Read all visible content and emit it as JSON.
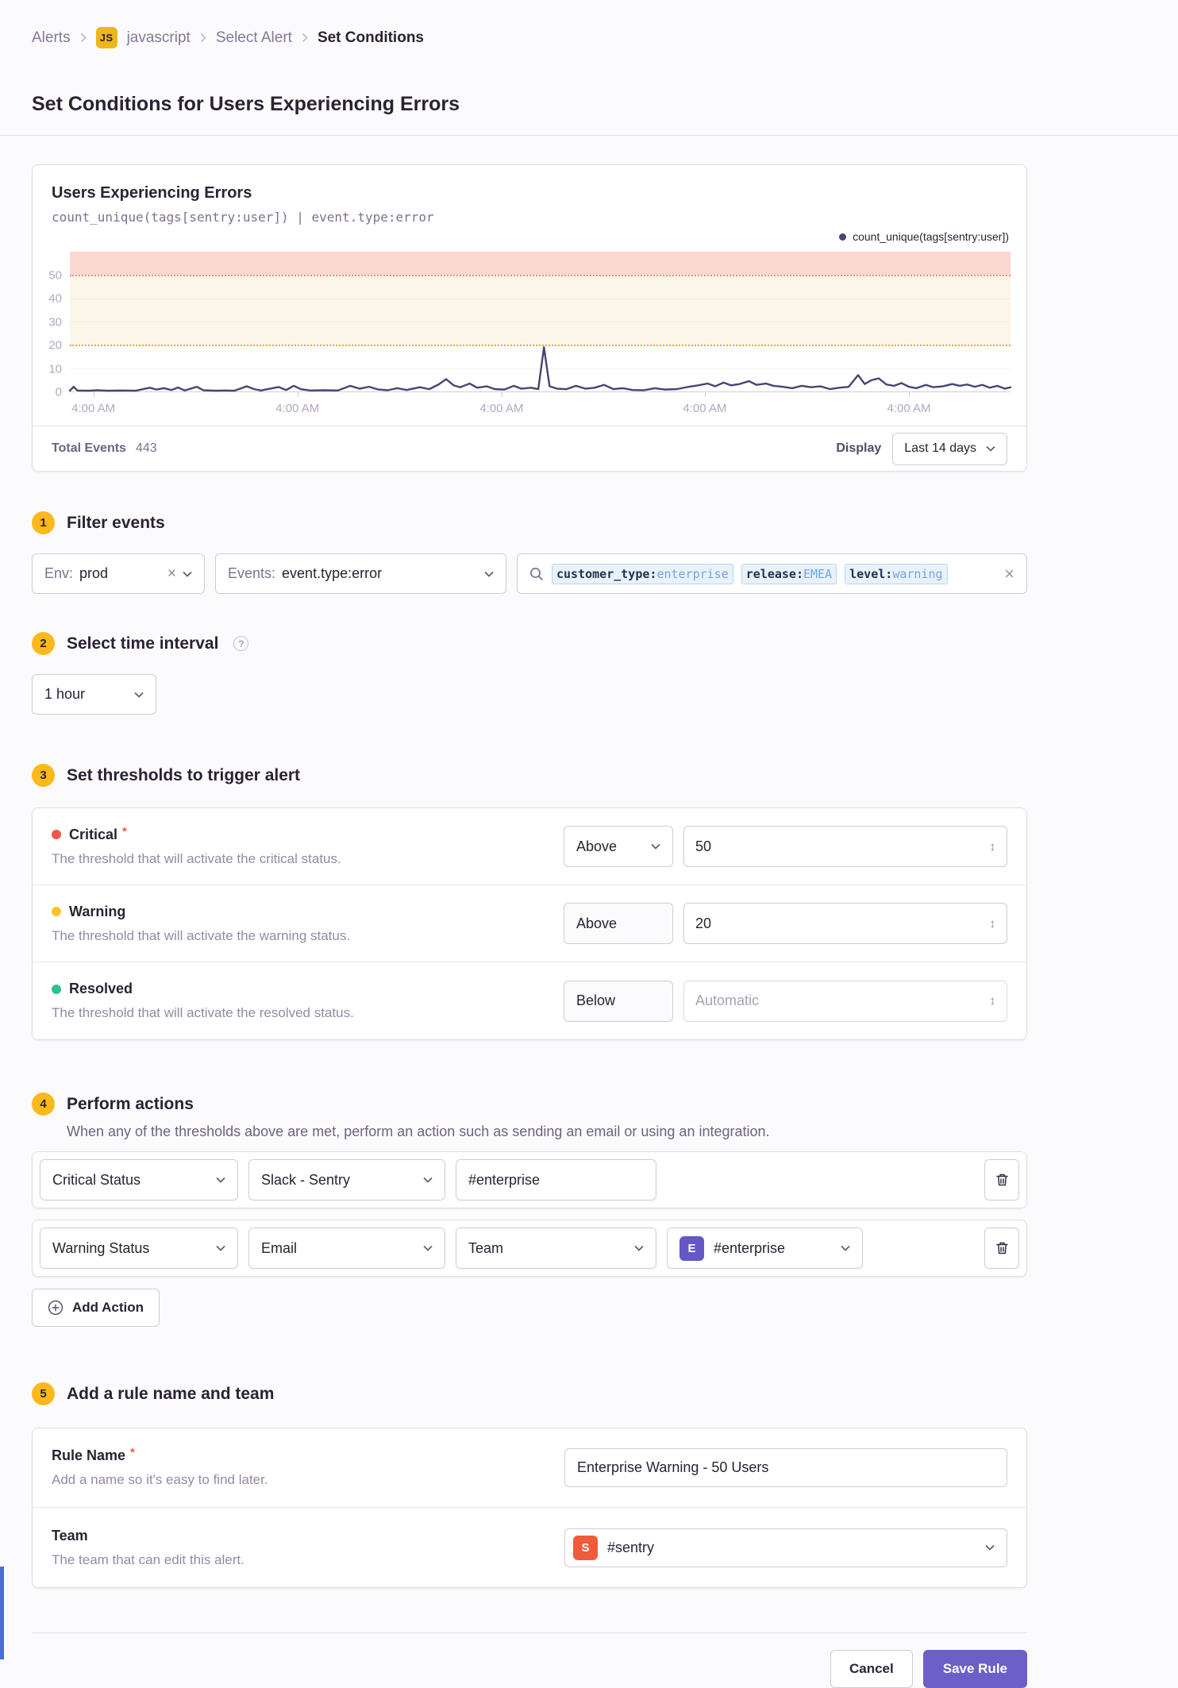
{
  "breadcrumb": {
    "items": [
      "Alerts",
      "javascript",
      "Select Alert",
      "Set Conditions"
    ],
    "project_badge": "JS"
  },
  "page_title": "Set Conditions for Users Experiencing Errors",
  "chart": {
    "title": "Users Experiencing Errors",
    "query": "count_unique(tags[sentry:user]) | event.type:error",
    "legend_label": "count_unique(tags[sentry:user])",
    "footer": {
      "total_events_label": "Total Events",
      "total_events_value": "443",
      "display_label": "Display",
      "display_value": "Last 14 days"
    }
  },
  "chart_data": {
    "type": "line",
    "series_name": "count_unique(tags[sentry:user])",
    "title": "Users Experiencing Errors",
    "ylim": [
      0,
      60
    ],
    "y_ticks": [
      0,
      10,
      20,
      30,
      40,
      50
    ],
    "gridline_values": [
      10,
      30,
      40
    ],
    "critical_threshold": 50,
    "warning_threshold": 20,
    "x_tick_labels": [
      "4:00 AM",
      "4:00 AM",
      "4:00 AM",
      "4:00 AM",
      "4:00 AM"
    ],
    "x_tick_fractions": [
      0.025,
      0.242,
      0.459,
      0.675,
      0.892
    ],
    "total_events": 443,
    "points": [
      [
        0.0,
        0.3
      ],
      [
        0.004,
        2.0
      ],
      [
        0.008,
        0.4
      ],
      [
        0.02,
        0.3
      ],
      [
        0.03,
        0.5
      ],
      [
        0.04,
        0.3
      ],
      [
        0.055,
        0.4
      ],
      [
        0.07,
        0.3
      ],
      [
        0.085,
        1.6
      ],
      [
        0.092,
        0.8
      ],
      [
        0.1,
        1.4
      ],
      [
        0.108,
        0.6
      ],
      [
        0.115,
        1.7
      ],
      [
        0.122,
        0.4
      ],
      [
        0.135,
        2.0
      ],
      [
        0.142,
        0.5
      ],
      [
        0.155,
        0.3
      ],
      [
        0.165,
        0.4
      ],
      [
        0.175,
        0.3
      ],
      [
        0.188,
        2.2
      ],
      [
        0.196,
        1.0
      ],
      [
        0.203,
        0.4
      ],
      [
        0.222,
        1.9
      ],
      [
        0.23,
        0.6
      ],
      [
        0.238,
        2.4
      ],
      [
        0.246,
        0.9
      ],
      [
        0.256,
        0.4
      ],
      [
        0.27,
        0.5
      ],
      [
        0.285,
        0.4
      ],
      [
        0.298,
        2.4
      ],
      [
        0.308,
        1.2
      ],
      [
        0.318,
        2.0
      ],
      [
        0.328,
        0.8
      ],
      [
        0.338,
        0.5
      ],
      [
        0.348,
        1.4
      ],
      [
        0.358,
        0.6
      ],
      [
        0.372,
        1.8
      ],
      [
        0.382,
        1.0
      ],
      [
        0.392,
        3.0
      ],
      [
        0.4,
        5.3
      ],
      [
        0.408,
        2.6
      ],
      [
        0.415,
        1.8
      ],
      [
        0.425,
        3.4
      ],
      [
        0.433,
        1.6
      ],
      [
        0.443,
        2.2
      ],
      [
        0.452,
        1.0
      ],
      [
        0.462,
        0.8
      ],
      [
        0.472,
        2.4
      ],
      [
        0.48,
        1.2
      ],
      [
        0.49,
        1.6
      ],
      [
        0.498,
        1.0
      ],
      [
        0.504,
        19.0
      ],
      [
        0.51,
        2.2
      ],
      [
        0.518,
        1.2
      ],
      [
        0.528,
        1.0
      ],
      [
        0.538,
        2.4
      ],
      [
        0.548,
        1.2
      ],
      [
        0.558,
        1.6
      ],
      [
        0.568,
        2.8
      ],
      [
        0.578,
        1.0
      ],
      [
        0.588,
        1.4
      ],
      [
        0.598,
        0.6
      ],
      [
        0.61,
        0.5
      ],
      [
        0.622,
        1.4
      ],
      [
        0.632,
        0.8
      ],
      [
        0.645,
        1.0
      ],
      [
        0.658,
        2.0
      ],
      [
        0.668,
        2.6
      ],
      [
        0.678,
        3.4
      ],
      [
        0.686,
        2.2
      ],
      [
        0.695,
        3.8
      ],
      [
        0.703,
        2.6
      ],
      [
        0.712,
        3.2
      ],
      [
        0.722,
        4.4
      ],
      [
        0.73,
        2.8
      ],
      [
        0.74,
        3.4
      ],
      [
        0.748,
        2.4
      ],
      [
        0.758,
        2.0
      ],
      [
        0.768,
        1.4
      ],
      [
        0.778,
        2.4
      ],
      [
        0.788,
        1.8
      ],
      [
        0.798,
        2.2
      ],
      [
        0.808,
        1.0
      ],
      [
        0.818,
        1.6
      ],
      [
        0.828,
        2.0
      ],
      [
        0.838,
        7.0
      ],
      [
        0.845,
        3.2
      ],
      [
        0.852,
        4.8
      ],
      [
        0.86,
        5.6
      ],
      [
        0.868,
        3.0
      ],
      [
        0.876,
        2.4
      ],
      [
        0.884,
        3.6
      ],
      [
        0.892,
        2.0
      ],
      [
        0.9,
        1.4
      ],
      [
        0.91,
        2.8
      ],
      [
        0.918,
        1.8
      ],
      [
        0.928,
        2.2
      ],
      [
        0.938,
        3.2
      ],
      [
        0.946,
        2.4
      ],
      [
        0.954,
        3.0
      ],
      [
        0.962,
        2.0
      ],
      [
        0.97,
        2.8
      ],
      [
        0.978,
        1.6
      ],
      [
        0.986,
        2.4
      ],
      [
        0.994,
        1.2
      ],
      [
        1.0,
        1.8
      ]
    ]
  },
  "steps": {
    "filter": {
      "number": "1",
      "title": "Filter events",
      "environment": {
        "label": "Env:",
        "value": "prod"
      },
      "events": {
        "label": "Events:",
        "value": "event.type:error"
      },
      "search_tokens": [
        {
          "key": "customer_type",
          "value": "enterprise"
        },
        {
          "key": "release",
          "value": "EMEA"
        },
        {
          "key": "level",
          "value": "warning"
        }
      ]
    },
    "interval": {
      "number": "2",
      "title": "Select time interval",
      "help": "?",
      "value": "1 hour"
    },
    "thresholds": {
      "number": "3",
      "title": "Set thresholds to trigger alert",
      "rows": [
        {
          "name": "Critical",
          "required": true,
          "description": "The threshold that will activate the critical status.",
          "comparator": "Above",
          "value": "50",
          "placeholder": ""
        },
        {
          "name": "Warning",
          "required": false,
          "description": "The threshold that will activate the warning status.",
          "comparator": "Above",
          "value": "20",
          "placeholder": ""
        },
        {
          "name": "Resolved",
          "required": false,
          "description": "The threshold that will activate the resolved status.",
          "comparator": "Below",
          "value": "",
          "placeholder": "Automatic"
        }
      ]
    },
    "actions": {
      "number": "4",
      "title": "Perform actions",
      "description": "When any of the thresholds above are met, perform an action such as sending an email or using an integration.",
      "row1": {
        "trigger": "Critical Status",
        "integration": "Slack - Sentry",
        "channel": "#enterprise"
      },
      "row2": {
        "trigger": "Warning Status",
        "method": "Email",
        "target": "Team",
        "team_badge": "E",
        "team": "#enterprise"
      },
      "add_label": "Add Action"
    },
    "naming": {
      "number": "5",
      "title": "Add a rule name and team",
      "rule_name": {
        "label": "Rule Name",
        "required": true,
        "description": "Add a name so it's easy to find later.",
        "value": "Enterprise Warning - 50 Users"
      },
      "team": {
        "label": "Team",
        "description": "The team that can edit this alert.",
        "badge": "S",
        "value": "#sentry"
      }
    }
  },
  "footer": {
    "cancel_label": "Cancel",
    "save_label": "Save Rule"
  },
  "colors": {
    "accent": "#6c5fc7",
    "step_badge": "#fdb81b",
    "project_badge": "#edb61a",
    "critical": "#f55549",
    "warning": "#ffc227",
    "resolved": "#2fbf93",
    "chart_line": "#444674",
    "critical_band": "#fbd8d0",
    "warning_band": "#fcf5e9",
    "team_badge_enterprise": "#6358c5",
    "team_badge_sentry": "#f05b3a",
    "token_value_text": "#71a5e4"
  }
}
